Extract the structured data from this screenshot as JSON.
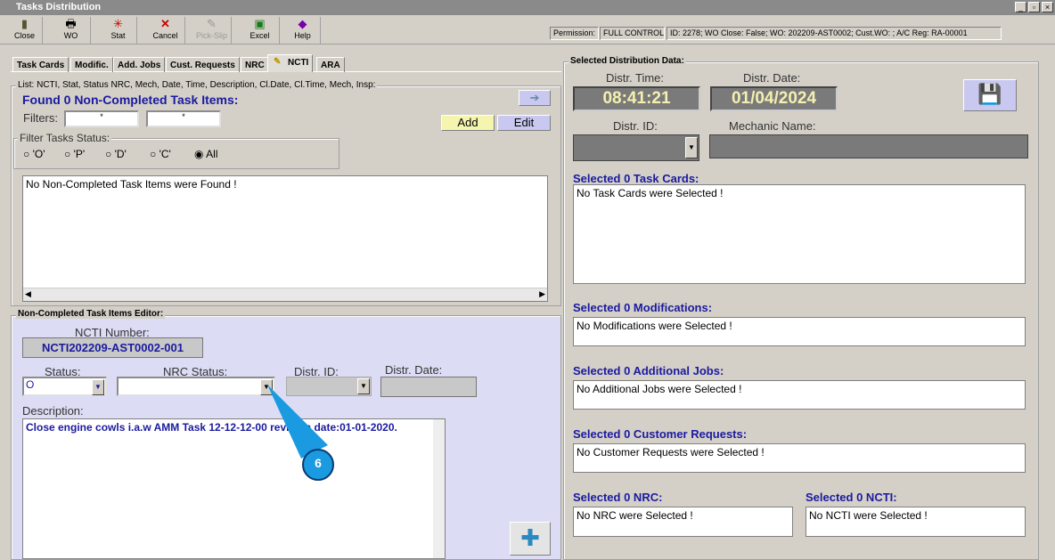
{
  "window": {
    "title": "Tasks Distribution"
  },
  "toolbar": [
    {
      "label": "Close",
      "icon": "door-icon"
    },
    {
      "label": "WO",
      "icon": "printer-icon"
    },
    {
      "label": "Stat",
      "icon": "stat-icon"
    },
    {
      "label": "Cancel",
      "icon": "cancel-icon"
    },
    {
      "label": "Pick-Slip",
      "icon": "pick-slip-icon"
    },
    {
      "label": "Excel",
      "icon": "excel-icon"
    },
    {
      "label": "Help",
      "icon": "help-icon"
    }
  ],
  "status": {
    "permission_label": "Permission:",
    "permission": "FULL CONTROL",
    "info": "ID: 2278; WO Close: False; WO: 202209-AST0002; Cust.WO:  ; A/C Reg: RA-00001"
  },
  "tabs": [
    "Task Cards",
    "Modific.",
    "Add. Jobs",
    "Cust. Requests",
    "NRC",
    "NCTI",
    "ARA"
  ],
  "list": {
    "legend": "List: NCTI, Stat, Status NRC, Mech, Date, Time, Description, Cl.Date, Cl.Time, Mech, Insp:",
    "found": "Found 0 Non-Completed Task Items:",
    "filters_label": "Filters:",
    "filter1": "*",
    "filter2": "*",
    "add": "Add",
    "edit": "Edit",
    "status_legend": "Filter Tasks Status:",
    "radios": [
      "'O'",
      "'P'",
      "'D'",
      "'C'",
      "All"
    ],
    "empty": "No Non-Completed Task Items were Found !"
  },
  "editor": {
    "legend": "Non-Completed Task Items Editor:",
    "ncti_label": "NCTI Number:",
    "ncti": "NCTI202209-AST0002-001",
    "status_label": "Status:",
    "status": "O",
    "nrc_label": "NRC Status:",
    "distr_id_label": "Distr. ID:",
    "distr_date_label": "Distr. Date:",
    "desc_label": "Description:",
    "desc": "Close engine cowls i.a.w AMM Task 12-12-12-00 revision date:01-01-2020."
  },
  "right": {
    "legend": "Selected Distribution Data:",
    "time_label": "Distr. Time:",
    "time": "08:41:21",
    "date_label": "Distr. Date:",
    "date": "01/04/2024",
    "id_label": "Distr. ID:",
    "mech_label": "Mechanic Name:",
    "sections": [
      {
        "title": "Selected 0 Task Cards:",
        "empty": "No Task Cards were Selected !"
      },
      {
        "title": "Selected 0 Modifications:",
        "empty": "No Modifications were Selected !"
      },
      {
        "title": "Selected 0 Additional Jobs:",
        "empty": "No Additional Jobs were Selected !"
      },
      {
        "title": "Selected 0 Customer Requests:",
        "empty": "No Customer Requests were Selected !"
      },
      {
        "title": "Selected 0 NRC:",
        "empty": "No NRC were Selected !"
      },
      {
        "title": "Selected 0 NCTI:",
        "empty": "No NCTI were Selected !"
      }
    ]
  },
  "callout": "6",
  "colors": {
    "callout": "#1a9ae0"
  }
}
